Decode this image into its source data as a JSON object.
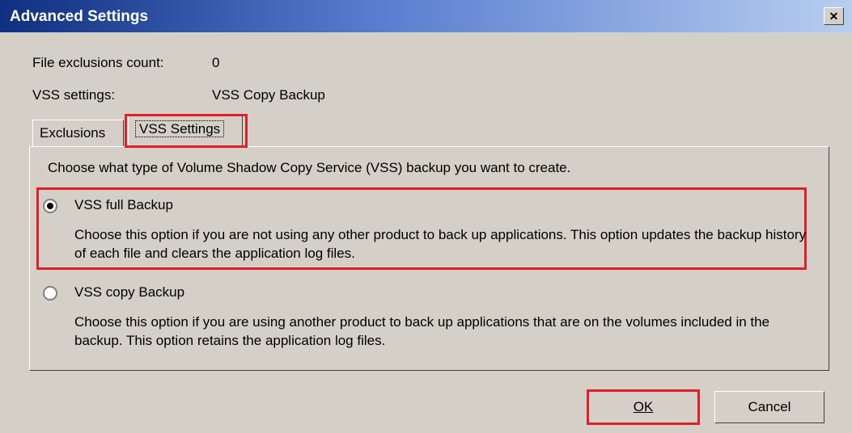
{
  "window": {
    "title": "Advanced Settings",
    "close_glyph": "✕"
  },
  "info": {
    "exclusions_label": "File exclusions count:",
    "exclusions_value": "0",
    "vss_label": "VSS settings:",
    "vss_value": "VSS Copy Backup"
  },
  "tabs": [
    {
      "label": "Exclusions",
      "selected": false
    },
    {
      "label": "VSS Settings",
      "selected": true
    }
  ],
  "panel": {
    "intro": "Choose what type of Volume Shadow Copy Service (VSS) backup you want to create.",
    "options": [
      {
        "label": "VSS full Backup",
        "selected": true,
        "description": "Choose this option if you are not using any other product to back up applications. This option updates the backup history of each file and clears the application log files."
      },
      {
        "label": "VSS copy Backup",
        "selected": false,
        "description": "Choose this option if you are using another product to back up applications that are on the volumes included in the backup. This option retains the application log files."
      }
    ]
  },
  "buttons": {
    "ok": "OK",
    "cancel": "Cancel"
  },
  "colors": {
    "highlight": "#e0202a",
    "title_bar": "#0f2f80",
    "dialog_bg": "#d4d0c8"
  }
}
